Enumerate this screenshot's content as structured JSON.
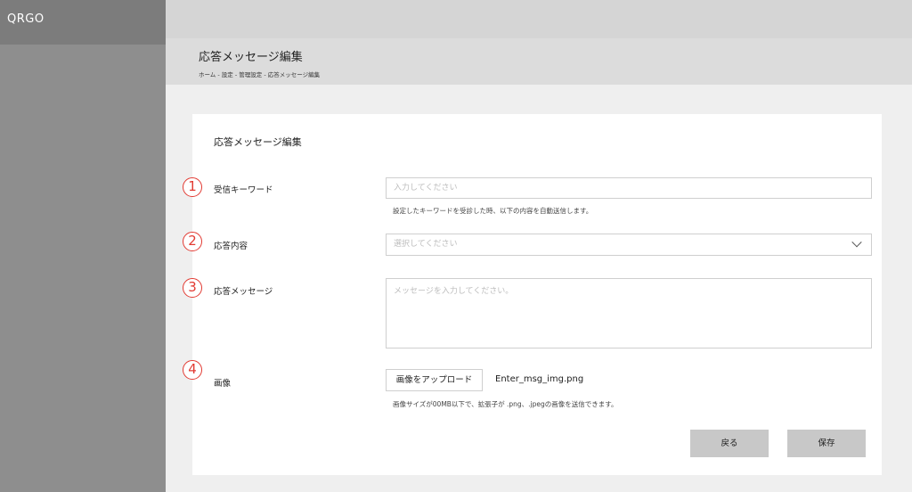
{
  "app": {
    "brand": "QRGO"
  },
  "header": {
    "title": "応答メッセージ編集",
    "breadcrumb": "ホーム - 設定 - 管理設定 - 応答メッセージ編集"
  },
  "card": {
    "title": "応答メッセージ編集",
    "fields": [
      {
        "number": "1",
        "label": "受信キーワード",
        "placeholder": "入力してください",
        "help": "設定したキーワードを受診した時、以下の内容を自動送信します。"
      },
      {
        "number": "2",
        "label": "応答内容",
        "placeholder": "選択してください"
      },
      {
        "number": "3",
        "label": "応答メッセージ",
        "placeholder": "メッセージを入力してください。"
      },
      {
        "number": "4",
        "label": "画像",
        "upload_label": "画像をアップロード",
        "filename": "Enter_msg_img.png",
        "help": "画像サイズが00MB以下で、拡張子が .png、.jpegの画像を送信できます。"
      }
    ],
    "back_label": "戻る",
    "save_label": "保存"
  },
  "colors": {
    "accent_marker": "#e23a32",
    "sidebar": "#8e8e8e"
  },
  "icons": {
    "select_chevron": "chevron-down-icon"
  }
}
